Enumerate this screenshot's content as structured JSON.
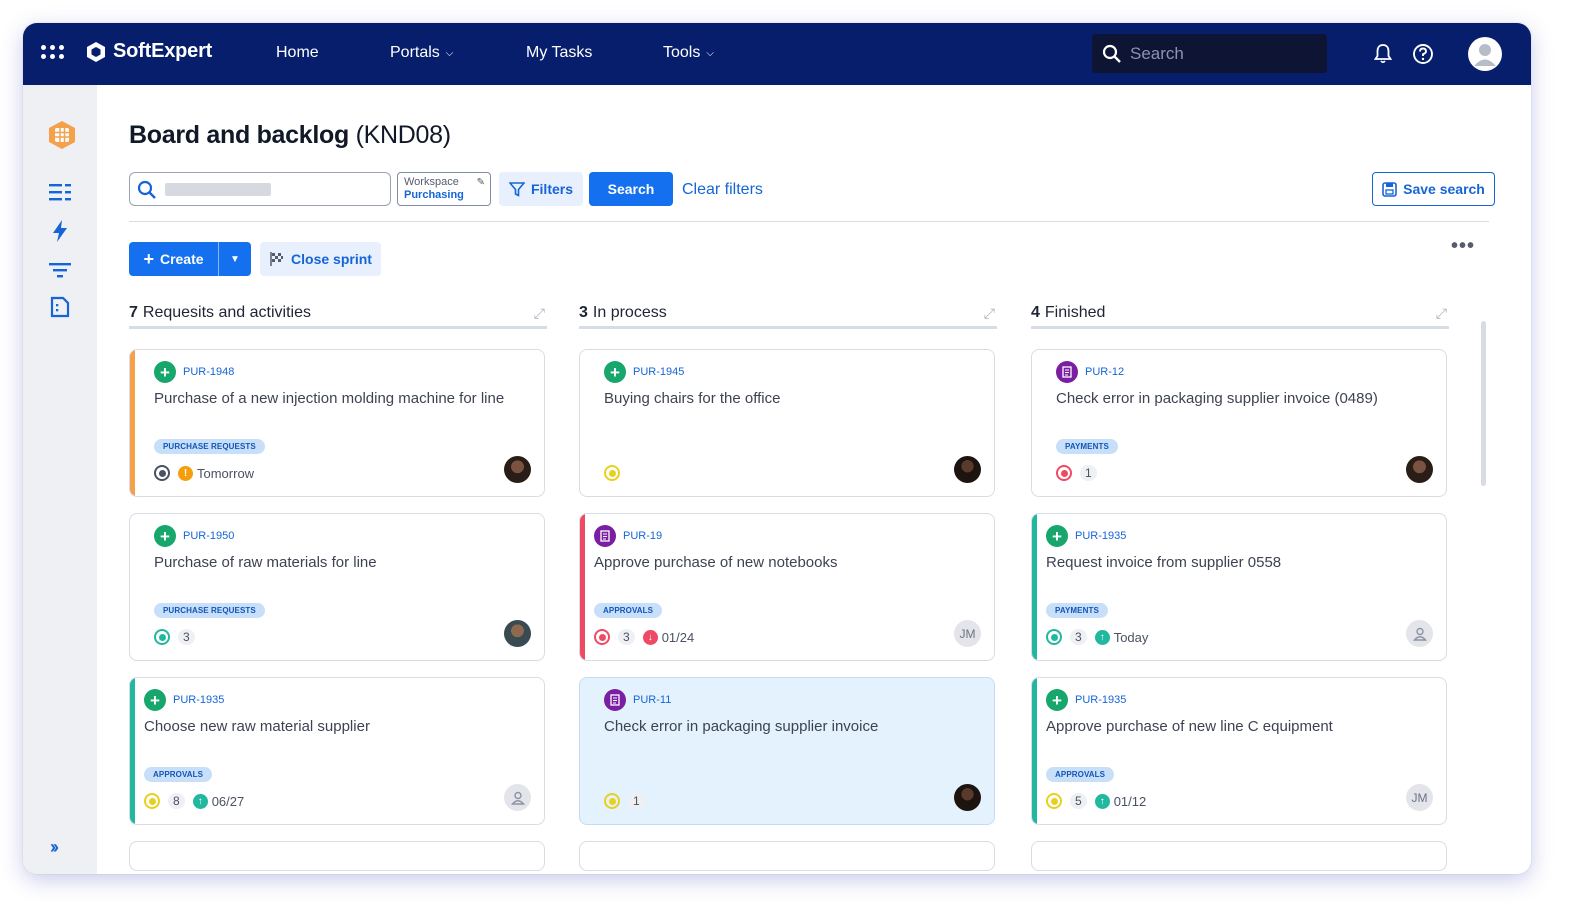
{
  "app": {
    "brand": "SoftExpert",
    "nav": [
      {
        "label": "Home",
        "has_menu": false
      },
      {
        "label": "Portals",
        "has_menu": true
      },
      {
        "label": "My Tasks",
        "has_menu": false
      },
      {
        "label": "Tools",
        "has_menu": true
      }
    ],
    "search_placeholder": "Search",
    "icons": [
      "apps-grid-icon",
      "bell-icon",
      "help-icon",
      "user-avatar-icon"
    ]
  },
  "sidebar": {
    "icons": [
      "board-app-icon",
      "list-icon",
      "lightning-icon",
      "filter-icon",
      "document-icon"
    ],
    "expand_label": "››"
  },
  "page": {
    "title": "Board and backlog",
    "code": "(KND08)"
  },
  "filters": {
    "search_value": "",
    "workspace_label": "Workspace",
    "workspace_value": "Purchasing",
    "filters_label": "Filters",
    "search_button": "Search",
    "clear_label": "Clear filters",
    "save_label": "Save search"
  },
  "actions": {
    "create_label": "Create",
    "close_sprint_label": "Close sprint",
    "more": "•••"
  },
  "colors": {
    "topbar": "#061e6c",
    "accent": "#1570ef",
    "orange": "#f5a04a",
    "red": "#ef4a64",
    "teal": "#22b8a0",
    "green_icon": "#17a66b",
    "purple_icon": "#7a1fa2"
  },
  "columns": [
    {
      "count": "7",
      "name": "Requesits and activities",
      "cards": [
        {
          "id": "PUR-1948",
          "title": "Purchase of a new injection molding machine for line",
          "tag": "PURCHASE REQUESTS",
          "type": "plus",
          "stripe": "#f5a04a",
          "status": "dark",
          "count": "",
          "due_icon": "!",
          "due_color": "#f59e0b",
          "due": "Tomorrow",
          "avatar": "photo",
          "initials": ""
        },
        {
          "id": "PUR-1950",
          "title": "Purchase of raw materials for line",
          "tag": "PURCHASE REQUESTS",
          "type": "plus",
          "stripe": "",
          "status": "teal",
          "count": "3",
          "due_icon": "",
          "due_color": "",
          "due": "",
          "avatar": "photo3",
          "initials": ""
        },
        {
          "id": "PUR-1935",
          "title": "Choose new raw material supplier",
          "tag": "APPROVALS",
          "type": "plus",
          "stripe": "#22b8a0",
          "status": "yellow",
          "count": "8",
          "due_icon": "↑",
          "due_color": "#22b8a0",
          "due": "06/27",
          "avatar": "generic",
          "initials": ""
        }
      ]
    },
    {
      "count": "3",
      "name": "In process",
      "cards": [
        {
          "id": "PUR-1945",
          "title": "Buying chairs for the office",
          "tag": "",
          "type": "plus",
          "stripe": "",
          "status": "yellow",
          "count": "",
          "due_icon": "",
          "due_color": "",
          "due": "",
          "avatar": "photo2",
          "initials": ""
        },
        {
          "id": "PUR-19",
          "title": "Approve purchase of new notebooks",
          "tag": "APPROVALS",
          "type": "doc",
          "stripe": "#ef4a64",
          "status": "red",
          "count": "3",
          "due_icon": "↓",
          "due_color": "#ef4a64",
          "due": "01/24",
          "avatar": "initials",
          "initials": "JM"
        },
        {
          "id": "PUR-11",
          "title": "Check error in packaging supplier invoice",
          "tag": "",
          "type": "doc",
          "stripe": "",
          "status": "yellow",
          "count": "1",
          "due_icon": "",
          "due_color": "",
          "due": "",
          "avatar": "photo2",
          "initials": "",
          "selected": true
        }
      ]
    },
    {
      "count": "4",
      "name": "Finished",
      "cards": [
        {
          "id": "PUR-12",
          "title": "Check error in packaging supplier invoice (0489)",
          "tag": "PAYMENTS",
          "type": "doc",
          "stripe": "",
          "status": "red",
          "count": "1",
          "due_icon": "",
          "due_color": "",
          "due": "",
          "avatar": "photo",
          "initials": ""
        },
        {
          "id": "PUR-1935",
          "title": "Request invoice from supplier 0558",
          "tag": "PAYMENTS",
          "type": "plus",
          "stripe": "#22b8a0",
          "status": "teal",
          "count": "3",
          "due_icon": "↑",
          "due_color": "#22b8a0",
          "due": "Today",
          "avatar": "generic",
          "initials": ""
        },
        {
          "id": "PUR-1935",
          "title": "Approve purchase of new line C equipment",
          "tag": "APPROVALS",
          "type": "plus",
          "stripe": "#22b8a0",
          "status": "yellow",
          "count": "5",
          "due_icon": "↑",
          "due_color": "#22b8a0",
          "due": "01/12",
          "avatar": "initials",
          "initials": "JM"
        }
      ]
    }
  ]
}
